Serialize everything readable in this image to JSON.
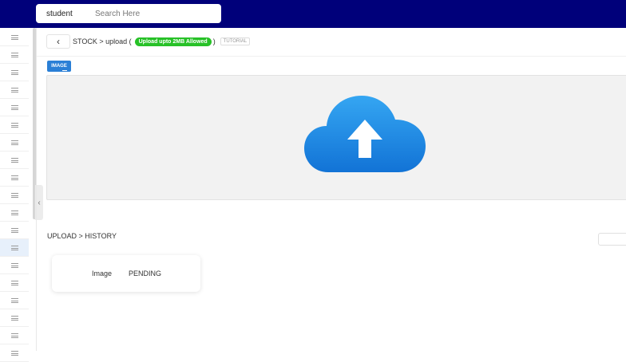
{
  "search": {
    "category": "student",
    "placeholder": "Search Here"
  },
  "sidebar": {
    "active_index": 12,
    "item_count": 19,
    "icon": "menu-lines-icon"
  },
  "header": {
    "breadcrumb": "STOCK > upload (",
    "badge": "Upload upto 2MB Allowed",
    "breadcrumb_close": ")",
    "tutorial": "TUTORIAL"
  },
  "upload": {
    "tab_label": "IMAGE",
    "icon": "cloud-upload-icon"
  },
  "history": {
    "label": "UPLOAD > HISTORY",
    "items": [
      {
        "type": "Image",
        "status": "PENDING"
      }
    ]
  },
  "colors": {
    "topbar": "#00007a",
    "accent": "#2a7fd6",
    "badge": "#27c127"
  }
}
